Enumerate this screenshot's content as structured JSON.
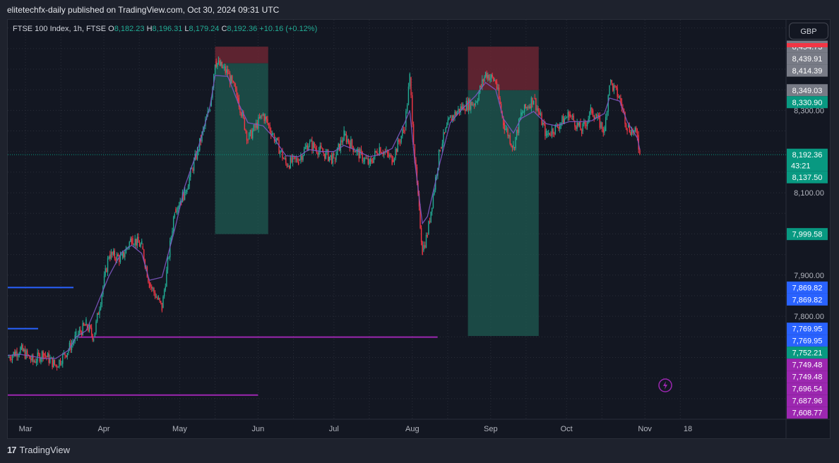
{
  "header": {
    "published": "elitetechfx-daily published on TradingView.com, Oct 30, 2024 09:31 UTC"
  },
  "legend": {
    "symbol": "FTSE 100 Index, 1h, FTSE",
    "o_label": "O",
    "o": "8,182.23",
    "h_label": "H",
    "h": "8,196.31",
    "l_label": "L",
    "l": "8,179.24",
    "c_label": "C",
    "c": "8,192.36",
    "change": "+10.16 (+0.12%)"
  },
  "currency_button": "GBP",
  "footer": {
    "brand": "TradingView"
  },
  "colors": {
    "up": "#22ab94",
    "down": "#f23645",
    "ma": "#7e57c2",
    "blue_line": "#2962ff",
    "magenta_line": "#9c27b0",
    "profit_zone": "#1f5b52",
    "loss_zone": "#6b2633"
  },
  "chart_data": {
    "type": "line",
    "title": "FTSE 100 Index, 1h, FTSE",
    "ylim": [
      7550,
      8520
    ],
    "grid": true,
    "x_ticks": [
      "Mar",
      "Apr",
      "May",
      "Jun",
      "Jul",
      "Aug",
      "Sep",
      "Oct",
      "Nov",
      "18"
    ],
    "y_ticks": [
      "8,300.00",
      "8,100.00",
      "7,900.00",
      "7,800.00"
    ],
    "series": [
      {
        "x": [
          "Feb 23",
          "Feb 28",
          "Mar 4",
          "Mar 8",
          "Mar 13",
          "Mar 18",
          "Mar 21",
          "Mar 25",
          "Mar 28",
          "Apr 3",
          "Apr 8",
          "Apr 12",
          "Apr 16",
          "Apr 19",
          "Apr 24",
          "Apr 29",
          "May 3",
          "May 8",
          "May 13",
          "May 15",
          "May 20",
          "May 24",
          "May 28",
          "Jun 3",
          "Jun 7",
          "Jun 12",
          "Jun 17",
          "Jun 21",
          "Jun 26",
          "Jul 1",
          "Jul 5",
          "Jul 10",
          "Jul 15",
          "Jul 19",
          "Jul 24",
          "Jul 29",
          "Jul 31",
          "Aug 2",
          "Aug 5",
          "Aug 7",
          "Aug 12",
          "Aug 16",
          "Aug 21",
          "Aug 26",
          "Aug 30",
          "Sep 3",
          "Sep 6",
          "Sep 10",
          "Sep 13",
          "Sep 18",
          "Sep 23",
          "Sep 27",
          "Oct 2",
          "Oct 7",
          "Oct 11",
          "Oct 16",
          "Oct 18",
          "Oct 22",
          "Oct 25",
          "Oct 29",
          "Oct 30"
        ],
        "values": [
          7700,
          7720,
          7690,
          7710,
          7680,
          7720,
          7750,
          7780,
          7750,
          7950,
          7940,
          7990,
          7970,
          7880,
          7820,
          8060,
          8100,
          8200,
          8310,
          8420,
          8390,
          8330,
          8230,
          8290,
          8240,
          8170,
          8180,
          8220,
          8200,
          8180,
          8240,
          8200,
          8170,
          8210,
          8180,
          8260,
          8380,
          8180,
          7960,
          8000,
          8210,
          8280,
          8310,
          8320,
          8390,
          8370,
          8270,
          8210,
          8290,
          8330,
          8240,
          8260,
          8290,
          8250,
          8300,
          8250,
          8370,
          8330,
          8260,
          8240,
          8192.36
        ]
      }
    ],
    "price_labels": [
      {
        "text": "8,454.73",
        "price": 8454.73,
        "color": "#787b86"
      },
      {
        "text": "8,439.91",
        "price": 8439.91,
        "color": "#787b86"
      },
      {
        "text": "8,414.39",
        "price": 8414.39,
        "color": "#787b86"
      },
      {
        "text": "8,349.03",
        "price": 8349.03,
        "color": "#787b86"
      },
      {
        "text": "8,330.90",
        "price": 8330.9,
        "color": "#089981"
      },
      {
        "text": "8,192.36",
        "price": 8192.36,
        "color": "#089981",
        "sub": "43:21"
      },
      {
        "text": "8,137.50",
        "price": 8137.5,
        "color": "#089981"
      },
      {
        "text": "7,999.58",
        "price": 7999.58,
        "color": "#089981"
      },
      {
        "text": "7,869.82",
        "price": 7869.82,
        "color": "#2962ff"
      },
      {
        "text": "7,869.82",
        "price": 7869.82,
        "color": "#2962ff"
      },
      {
        "text": "7,769.95",
        "price": 7769.95,
        "color": "#2962ff"
      },
      {
        "text": "7,769.95",
        "price": 7769.95,
        "color": "#2962ff"
      },
      {
        "text": "7,752.21",
        "price": 7752.21,
        "color": "#089981"
      },
      {
        "text": "7,749.48",
        "price": 7749.48,
        "color": "#9c27b0"
      },
      {
        "text": "7,749.48",
        "price": 7749.48,
        "color": "#9c27b0"
      },
      {
        "text": "7,696.54",
        "price": 7696.54,
        "color": "#9c27b0"
      },
      {
        "text": "7,687.96",
        "price": 7687.96,
        "color": "#9c27b0"
      },
      {
        "text": "7,608.77",
        "price": 7608.77,
        "color": "#9c27b0"
      }
    ],
    "horizontal_levels": [
      {
        "price": 7869.82,
        "from": "Feb 23",
        "to": "Mar 20",
        "color": "#2962ff"
      },
      {
        "price": 7769.95,
        "from": "Feb 23",
        "to": "Mar 6",
        "color": "#2962ff"
      },
      {
        "price": 7749.48,
        "from": "Mar 22",
        "to": "Aug 11",
        "color": "#9c27b0"
      },
      {
        "price": 7608.77,
        "from": "Feb 23",
        "to": "Jun 1",
        "color": "#9c27b0"
      }
    ],
    "position_tools": [
      {
        "type": "short",
        "from": "May 15",
        "to": "Jun 5",
        "entry": 8414.39,
        "stop": 8454.73,
        "target": 7999.58
      },
      {
        "type": "short",
        "from": "Aug 23",
        "to": "Sep 20",
        "entry": 8349.03,
        "stop": 8454.73,
        "target": 7752.21
      }
    ]
  }
}
